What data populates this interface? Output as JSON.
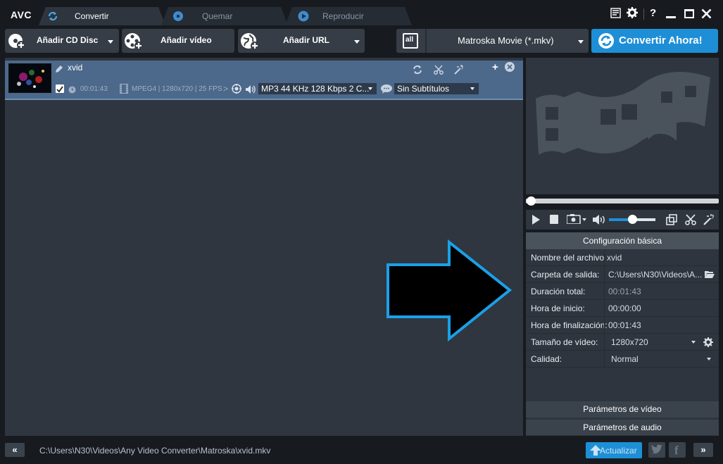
{
  "app": {
    "logo": "AVC"
  },
  "tabs": [
    {
      "label": "Convertir"
    },
    {
      "label": "Quemar"
    },
    {
      "label": "Reproducir"
    }
  ],
  "toolbar": {
    "add_cd": "Añadir CD Disc",
    "add_video": "Añadir vídeo",
    "add_url": "Añadir URL",
    "format_icon_text": "all",
    "format": "Matroska Movie (*.mkv)",
    "convert": "Convertir Ahora!"
  },
  "item": {
    "name": "xvid",
    "duration": "00:01:43",
    "video_info": "MPEG4 | 1280x720 | 25 FPS",
    "audio": "MP3 44 KHz 128 Kbps 2 C...",
    "subtitles": "Sin Subtítulos"
  },
  "settings": {
    "header": "Configuración básica",
    "rows": [
      {
        "key": "Nombre del archivo",
        "value": "xvid"
      },
      {
        "key": "Carpeta de salida:",
        "value": "C:\\Users\\N30\\Videos\\A..."
      },
      {
        "key": "Duración total:",
        "value": "00:01:43"
      },
      {
        "key": "Hora de inicio:",
        "value": "00:00:00"
      },
      {
        "key": "Hora de finalización:",
        "value": "00:01:43"
      },
      {
        "key": "Tamaño de vídeo:",
        "value": "1280x720"
      },
      {
        "key": "Calidad:",
        "value": "Normal"
      }
    ],
    "video_params": "Parámetros de vídeo",
    "audio_params": "Parámetros de audio"
  },
  "status": {
    "path": "C:\\Users\\N30\\Videos\\Any Video Converter\\Matroska\\xvid.mkv",
    "update": "Actualizar"
  },
  "colors": {
    "accent": "#1e8fd6",
    "item_bg": "#4c688b",
    "arrow_stroke": "#1aa0e8"
  }
}
